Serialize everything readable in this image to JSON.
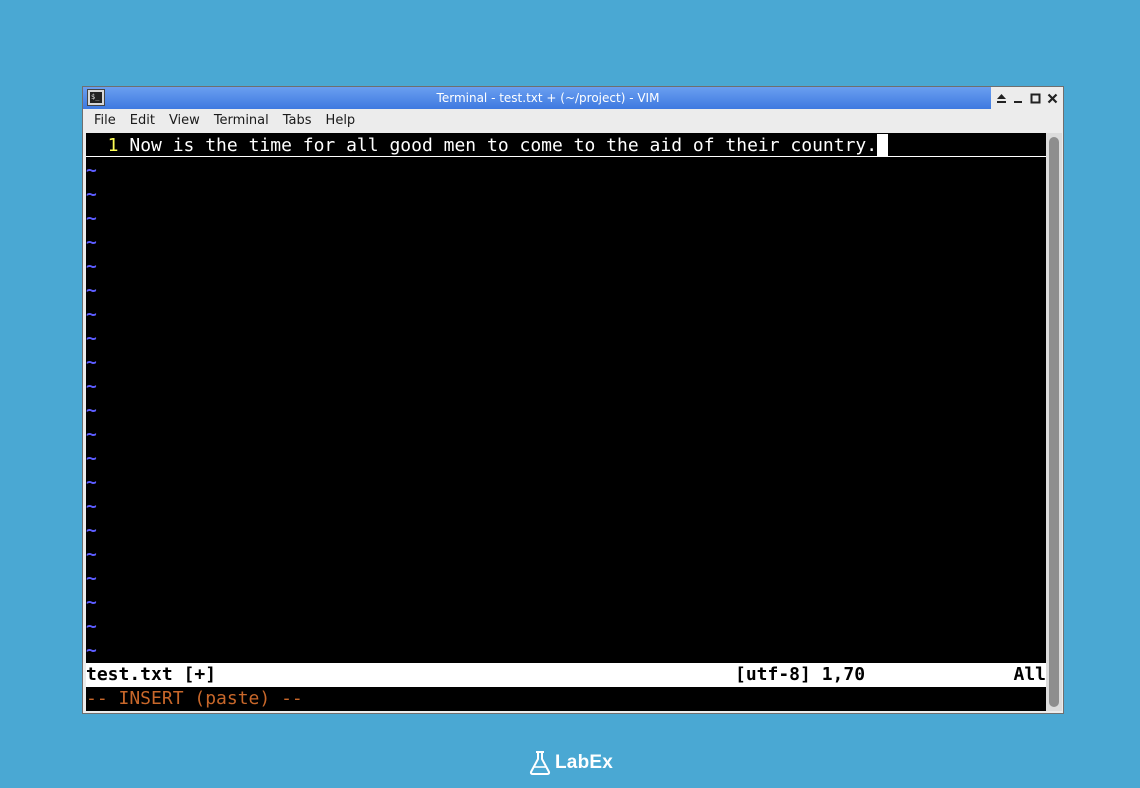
{
  "window": {
    "title": "Terminal - test.txt + (~/project) - VIM"
  },
  "menu": {
    "items": [
      "File",
      "Edit",
      "View",
      "Terminal",
      "Tabs",
      "Help"
    ]
  },
  "editor": {
    "line_number": "  1 ",
    "line_text": "Now is the time for all good men to come to the aid of their country.",
    "empty_line_marker": "~",
    "empty_line_count": 21
  },
  "statusline": {
    "filename": "test.txt [+]",
    "info": "[utf-8] 1,70",
    "position": "All"
  },
  "cmdline": {
    "mode": "-- INSERT (paste) --"
  },
  "branding": {
    "logo_text": "LabEx"
  },
  "colors": {
    "desktop": "#4aa8d3",
    "titlebar": "#3e79e0",
    "line_number": "#ffff55",
    "tilde": "#5c5cff",
    "mode_text": "#c8672a"
  }
}
